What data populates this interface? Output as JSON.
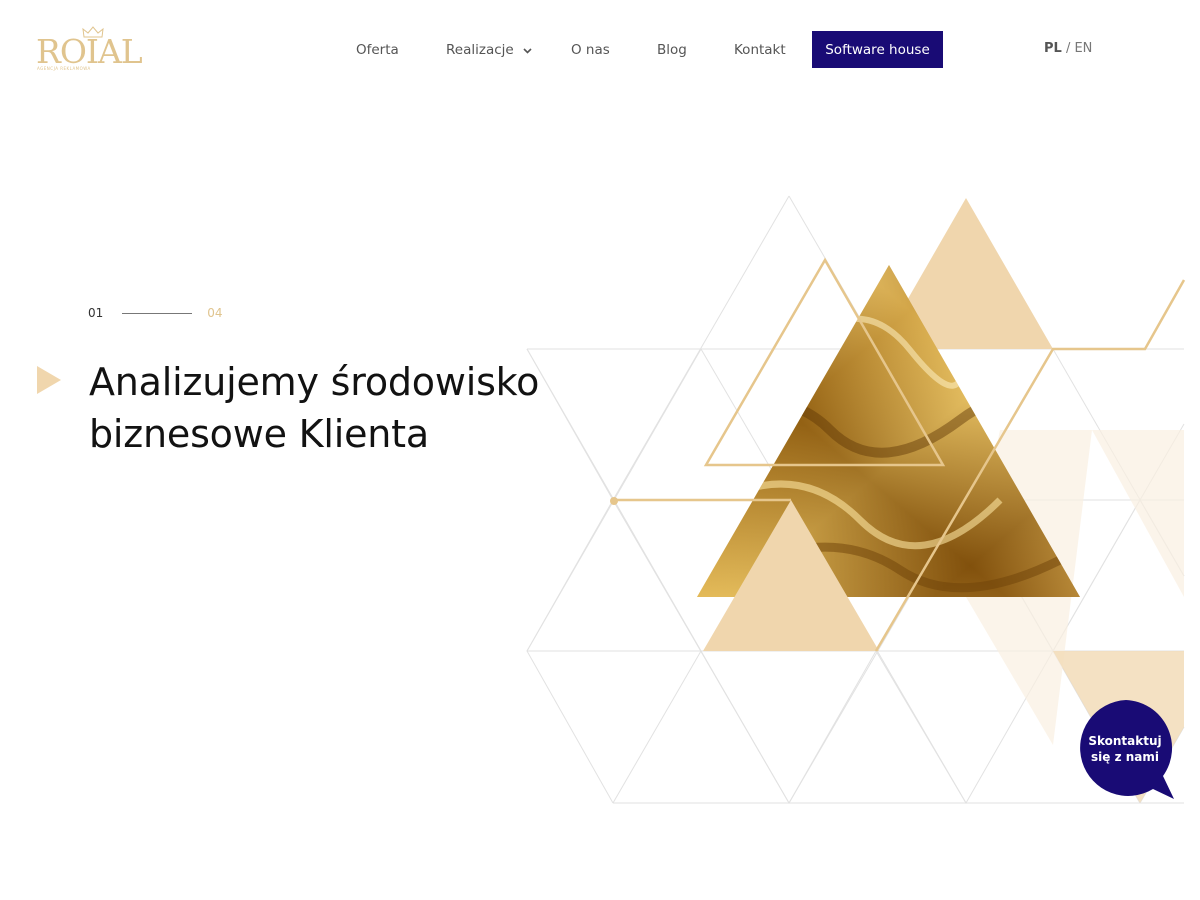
{
  "header": {
    "logo": {
      "wordmark": "ROIAL",
      "tagline": "AGENCJA REKLAMOWA",
      "gold_color": "#e0c48e"
    },
    "nav": {
      "items": [
        {
          "label": "Oferta"
        },
        {
          "label": "Realizacje",
          "has_dropdown": true
        },
        {
          "label": "O nas"
        },
        {
          "label": "Blog"
        },
        {
          "label": "Kontakt"
        }
      ],
      "cta_label": "Software house",
      "cta_color": "#190b75"
    },
    "language": {
      "active": "PL",
      "separator": " / ",
      "other": "EN"
    }
  },
  "hero": {
    "slide_current": "01",
    "slide_total": "04",
    "headline_line1": "Analizujemy środowisko",
    "headline_line2": "biznesowe Klienta",
    "play_icon": "play-triangle-icon",
    "accent_color": "#e0c48e"
  },
  "chat": {
    "line1": "Skontaktuj",
    "line2": "się z nami",
    "color": "#190b75"
  }
}
